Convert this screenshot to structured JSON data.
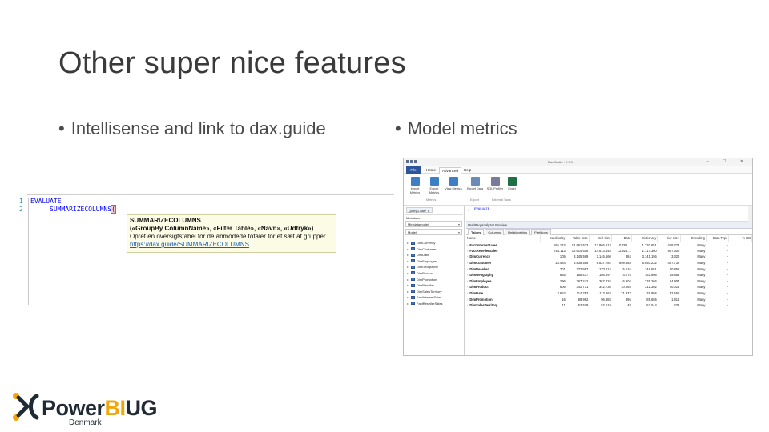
{
  "slide": {
    "title": "Other super nice features",
    "bullets": [
      "Intellisense and link to dax.guide",
      "Model metrics"
    ],
    "bullet_char": "•"
  },
  "editor": {
    "line_numbers": [
      "1",
      "2"
    ],
    "line1": "EVALUATE",
    "line2": "SUMMARIZECOLUMNS",
    "paren": "(",
    "tooltip": {
      "name": "SUMMARIZECOLUMNS",
      "signature": "(«GroupBy ColumnName», «Filter Table», «Navn», «Udtryk»)",
      "description": "Opret en oversigtstabel for de anmodede totaler for et sæt af grupper.",
      "link": "https://dax.guide/SUMMARIZECOLUMNS"
    }
  },
  "app": {
    "title": "DaxStudio - 2.9.9",
    "window_controls": "– ☐ ✕",
    "tabs": [
      "File",
      "Home",
      "Advanced",
      "Help"
    ],
    "ribbon": {
      "buttons": [
        {
          "label": "Import Metrics",
          "color": "#3c7fc4"
        },
        {
          "label": "Export Metrics",
          "color": "#3c7fc4"
        },
        {
          "label": "View Metrics",
          "color": "#3c7fc4"
        },
        {
          "label": "Export Data",
          "color": "#6a8bb8"
        },
        {
          "label": "SQL Profiler",
          "color": "#7a7a9a"
        },
        {
          "label": "Excel",
          "color": "#1e7145"
        }
      ],
      "groups": [
        "Metrics",
        "Export",
        "External Tools"
      ]
    },
    "document_tab": "Query1.dax* ✕",
    "metadata_label": "Metadata",
    "database_dropdown": "Minidatamodel",
    "model_dropdown": "Model",
    "tree_items": [
      "DimCurrency",
      "DimCustomer",
      "DimDate",
      "DimEmployee",
      "DimGeography",
      "DimProduct",
      "DimPromotion",
      "DimReseller",
      "DimSalesTerritory",
      "FactInternetSales",
      "FactResellerSales"
    ],
    "query_editor": {
      "line_number": "1",
      "text": "EVALUATE"
    },
    "results_title": "VertiPaq Analyzer Preview",
    "result_tabs": [
      "Tables",
      "Columns",
      "Relationships",
      "Partitions"
    ],
    "table_headers": [
      "Name",
      "Cardinality",
      "Table Size",
      "Col Size",
      "Data",
      "Dictionary",
      "Hier Size",
      "Encoding",
      "Data Type",
      "% DB"
    ],
    "table_rows": [
      [
        "FactInternetSales",
        "165.174",
        "12.661.573",
        "12.866.613",
        "10.782....",
        "1.730.651",
        "428.272",
        "Many",
        "-"
      ],
      [
        "FactResellerSales",
        "751.113",
        "10.614.618",
        "14.613.648",
        "12.928....",
        "1.717.360",
        "967.300",
        "Many",
        "-"
      ],
      [
        "DimCurrency",
        "105",
        "3.145.569",
        "3.145.660",
        "384",
        "3.141.156",
        "3.320",
        "Many",
        "-"
      ],
      [
        "DimCustomer",
        "18.484",
        "6.836.556",
        "6.837.782",
        "699.688",
        "5.650.232",
        "487.732",
        "Many",
        "-"
      ],
      [
        "DimReseller",
        "701",
        "272.997",
        "272.114",
        "5.616",
        "246.651",
        "20.856",
        "Many",
        "-"
      ],
      [
        "DimGeography",
        "655",
        "185.437",
        "186.297",
        "4.275",
        "162.905",
        "19.856",
        "Many",
        "-"
      ],
      [
        "DimEmployee",
        "296",
        "367.242",
        "367.234",
        "6.904",
        "335.266",
        "24.904",
        "Many",
        "-"
      ],
      [
        "DimProduct",
        "606",
        "342.731",
        "342.736",
        "10.068",
        "312.302",
        "20.016",
        "Many",
        "-"
      ],
      [
        "DimDate",
        "3.652",
        "114.253",
        "113.263",
        "21.937",
        "29.956",
        "32.560",
        "Many",
        "-"
      ],
      [
        "DimPromotion",
        "16",
        "89.962",
        "96.983",
        "396",
        "85.665",
        "1.816",
        "Many",
        "-"
      ],
      [
        "DimSalesTerritory",
        "11",
        "52.519",
        "52.519",
        "48",
        "52.044",
        "432",
        "Many",
        "-"
      ]
    ]
  },
  "logo": {
    "word_power": "Power",
    "word_bi": "BI",
    "word_ug": "UG",
    "subtitle": "Denmark",
    "colors": {
      "orange": "#f2a60c",
      "dark": "#1f2a35"
    }
  }
}
